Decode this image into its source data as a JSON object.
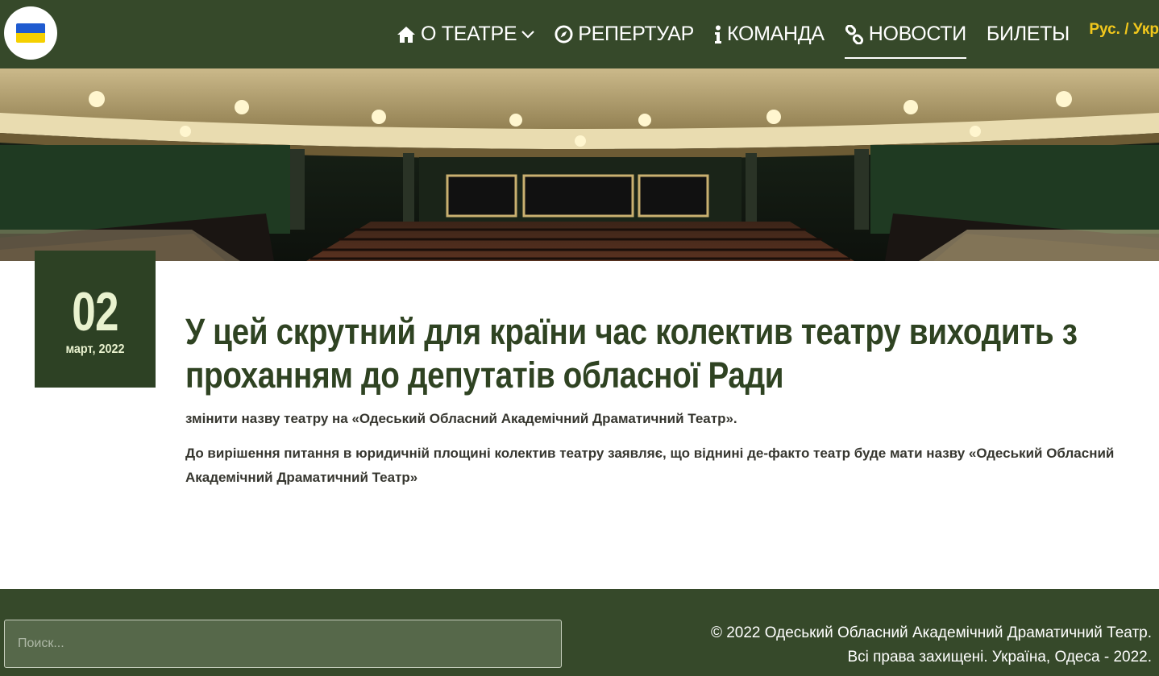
{
  "header": {
    "nav": [
      {
        "label": "О ТЕАТРЕ",
        "icon": "home-icon"
      },
      {
        "label": "РЕПЕРТУАР",
        "icon": "compass-icon"
      },
      {
        "label": "КОМАНДА",
        "icon": "info-icon"
      },
      {
        "label": "НОВОСТИ",
        "icon": "link-icon"
      },
      {
        "label": "БИЛЕТЫ"
      }
    ],
    "lang": "Рус. / Укр",
    "logo_icon": "ukraine-flag-icon"
  },
  "article": {
    "day": "02",
    "month_year": "март, 2022",
    "title": "У цей скрутний для країни час колектив театру виходить з проханням до депутатів обласної Ради",
    "lead": "змінити назву театру на «Одеський Обласний Академічний Драматичний Театр».",
    "body": "До вирішення питання в юридичній площині колектив театру заявляє, що віднині де-факто театр буде мати назву «Одеський Обласний Академічний Драматичний Театр»"
  },
  "footer": {
    "search_placeholder": "Поиск...",
    "copyright_line1": "© 2022 Одеський Обласний Академічний Драматичний Театр.",
    "copyright_line2": "Всі права захищені. Україна, Одеса - 2022."
  },
  "colors": {
    "header_bg": "#36492a",
    "date_bg": "#2d4124",
    "title": "#2f4322",
    "lang": "#f2c81c"
  }
}
